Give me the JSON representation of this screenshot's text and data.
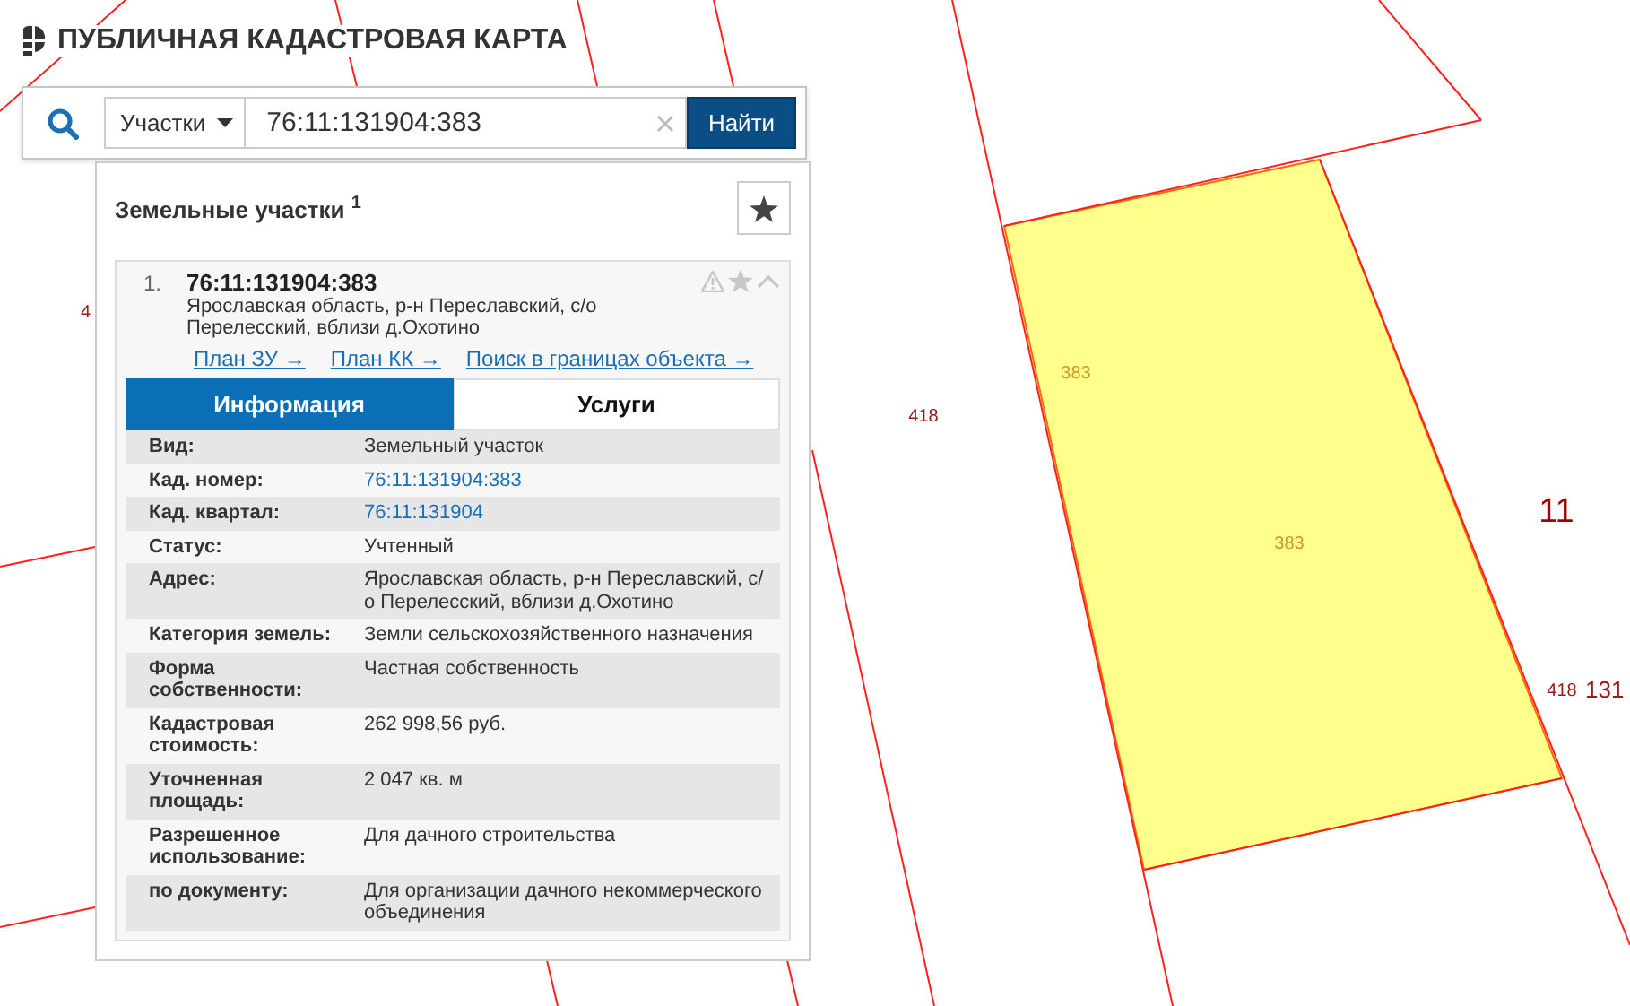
{
  "header": {
    "title": "ПУБЛИЧНАЯ КАДАСТРОВАЯ КАРТА"
  },
  "search": {
    "category": "Участки",
    "value": "76:11:131904:383",
    "button": "Найти"
  },
  "results": {
    "title": "Земельные участки $^{1}$",
    "items": [
      {
        "number": "1.",
        "cadastral_number": "76:11:131904:383",
        "address": "Ярославская область, р-н Переславский, с/о Перелесский, вблизи д.Охотино",
        "expanded": true,
        "links": [
          "План ЗУ →",
          "План КК →",
          "Поиск в границах объекта →"
        ],
        "tabs": [
          {
            "label": "Информация",
            "selected": true
          },
          {
            "label": "Услуги",
            "selected": false
          }
        ],
        "fields": [
          {
            "label": "Вид:",
            "value": "Земельный участок",
            "kind": "text"
          },
          {
            "label": "Кад. номер:",
            "value": "76:11:131904:383",
            "kind": "link"
          },
          {
            "label": "Кад. квартал:",
            "value": "76:11:131904",
            "kind": "link"
          },
          {
            "label": "Статус:",
            "value": "Учтенный",
            "kind": "text"
          },
          {
            "label": "Адрес:",
            "value": "Ярославская область, р-н Переславский, с/о Перелесский, вблизи д.Охотино",
            "kind": "text"
          },
          {
            "label": "Категория земель:",
            "value": "Земли сельскохозяйственного назначения",
            "kind": "text"
          },
          {
            "label": "Форма собственности:",
            "value": "Частная собственность",
            "kind": "text"
          },
          {
            "label": "Кадастровая стоимость:",
            "value": "262 998,56 руб.",
            "kind": "text"
          },
          {
            "label": "Уточненная площадь:",
            "value": "2 047 кв. м",
            "kind": "text"
          },
          {
            "label": "Разрешенное использование:",
            "value": "Для дачного строительства",
            "kind": "text"
          },
          {
            "label": "по документу:",
            "value": "Для организации дачного некоммерческого объединения",
            "kind": "text"
          }
        ]
      }
    ]
  },
  "map": {
    "labels": [
      {
        "text": "4",
        "kind": "parcel"
      },
      {
        "text": "418",
        "kind": "parcel"
      },
      {
        "text": "383",
        "kind": "selected"
      },
      {
        "text": "383",
        "kind": "selected"
      },
      {
        "text": "11",
        "kind": "quarter"
      },
      {
        "text": "418",
        "kind": "parcel"
      },
      {
        "text": "131",
        "kind": "block"
      }
    ]
  }
}
